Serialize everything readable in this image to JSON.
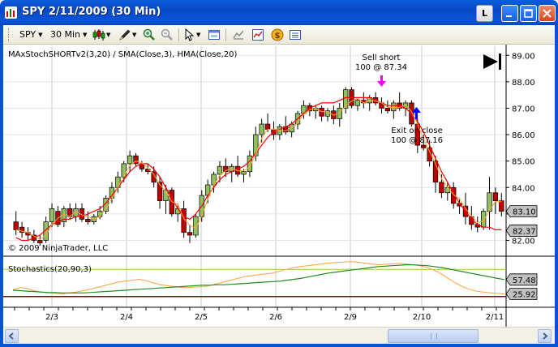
{
  "window": {
    "title": "SPY  2/11/2009 (30 Min)",
    "buttons": {
      "l_label": "L",
      "minimize": "–",
      "maximize": "□",
      "close": "✕"
    }
  },
  "toolbar": {
    "instrument": "SPY",
    "interval": "30 Min",
    "icons": [
      "candlestick-style-icon",
      "pencil-draw-icon",
      "zoom-in-icon",
      "zoom-out-icon",
      "cursor-icon",
      "properties-icon",
      "data-box-icon",
      "chart-trader-icon",
      "coin-icon",
      "list-icon"
    ]
  },
  "price_panel": {
    "label": "MAxStochSHORTv2(3,20) / SMA(Close,3), HMA(Close,20)",
    "copyright": "© 2009 NinjaTrader, LLC",
    "axis_ticks": [
      "89.00",
      "88.00",
      "87.00",
      "86.00",
      "85.00",
      "84.00",
      "83.00",
      "82.00"
    ],
    "price_markers": [
      {
        "label": "83.10",
        "color": "#c0c0c0"
      },
      {
        "label": "82.37",
        "color": "#c0c0c0"
      }
    ],
    "annotations": {
      "sell_short": [
        "Sell short",
        "100 @ 87.34"
      ],
      "exit_on_close": [
        "Exit on close",
        "100 @ 87.16"
      ]
    },
    "colors": {
      "up": "#90c060",
      "down": "#c00000",
      "hma": "#ff0000",
      "sma": "#ffaa30",
      "sell_arrow": "#ff00ff",
      "buy_arrow": "#0000ff"
    }
  },
  "stoch_panel": {
    "label": "Stochastics(20,90,3)",
    "markers": [
      {
        "label": "57.48",
        "color": "#c0c0c0"
      },
      {
        "label": "25.92",
        "color": "#c0c0c0"
      }
    ],
    "colors": {
      "d": "#228b22",
      "k": "#ffa040",
      "upper": "#9acd32",
      "lower": "#8b0000"
    }
  },
  "x_axis": {
    "labels": [
      "2/3",
      "2/4",
      "2/5",
      "2/6",
      "2/9",
      "2/10",
      "2/11"
    ]
  },
  "chart_data": {
    "type": "candlestick",
    "title": "SPY  2/11/2009 (30 Min)",
    "ylim": [
      81.8,
      89.1
    ],
    "series": [
      {
        "name": "SPY",
        "ohlc": [
          [
            82.7,
            83.1,
            82.2,
            82.4
          ],
          [
            82.5,
            82.7,
            82.1,
            82.3
          ],
          [
            82.3,
            82.5,
            82.0,
            82.2
          ],
          [
            82.2,
            82.4,
            81.9,
            82.0
          ],
          [
            82.0,
            82.2,
            81.8,
            81.9
          ],
          [
            82.0,
            82.9,
            81.9,
            82.7
          ],
          [
            82.7,
            83.4,
            82.5,
            83.2
          ],
          [
            83.1,
            83.3,
            82.5,
            82.6
          ],
          [
            82.7,
            83.3,
            82.5,
            83.2
          ],
          [
            83.2,
            83.4,
            82.8,
            82.9
          ],
          [
            82.9,
            83.4,
            82.7,
            83.2
          ],
          [
            83.2,
            83.4,
            82.7,
            82.8
          ],
          [
            82.8,
            83.1,
            82.6,
            82.7
          ],
          [
            82.7,
            83.0,
            82.6,
            82.9
          ],
          [
            82.9,
            83.3,
            82.8,
            83.1
          ],
          [
            83.1,
            83.7,
            83.0,
            83.6
          ],
          [
            83.6,
            84.2,
            83.4,
            84.0
          ],
          [
            84.0,
            84.6,
            83.8,
            84.4
          ],
          [
            84.4,
            85.0,
            84.2,
            84.9
          ],
          [
            84.9,
            85.4,
            84.6,
            85.2
          ],
          [
            85.2,
            85.3,
            84.8,
            84.9
          ],
          [
            84.9,
            85.0,
            84.6,
            84.7
          ],
          [
            84.7,
            84.9,
            84.5,
            84.6
          ],
          [
            84.6,
            84.8,
            84.0,
            84.2
          ],
          [
            84.2,
            84.4,
            83.2,
            83.5
          ],
          [
            83.5,
            84.1,
            83.0,
            83.9
          ],
          [
            83.9,
            84.0,
            82.9,
            83.0
          ],
          [
            83.0,
            83.4,
            82.7,
            83.2
          ],
          [
            83.2,
            83.5,
            82.1,
            82.3
          ],
          [
            82.3,
            82.6,
            81.9,
            82.2
          ],
          [
            82.2,
            83.0,
            82.1,
            82.9
          ],
          [
            82.9,
            83.9,
            82.7,
            83.7
          ],
          [
            83.7,
            84.3,
            83.4,
            84.1
          ],
          [
            84.1,
            84.6,
            83.8,
            84.5
          ],
          [
            84.5,
            85.0,
            84.2,
            84.8
          ],
          [
            84.8,
            85.1,
            84.4,
            84.6
          ],
          [
            84.6,
            84.9,
            84.2,
            84.8
          ],
          [
            84.8,
            85.2,
            84.4,
            84.5
          ],
          [
            84.5,
            84.7,
            84.2,
            84.6
          ],
          [
            84.6,
            85.4,
            84.4,
            85.2
          ],
          [
            85.2,
            86.3,
            85.0,
            86.0
          ],
          [
            86.0,
            86.6,
            85.7,
            86.4
          ],
          [
            86.4,
            86.8,
            86.1,
            86.2
          ],
          [
            86.2,
            86.5,
            85.8,
            86.0
          ],
          [
            86.0,
            86.4,
            85.8,
            86.3
          ],
          [
            86.3,
            86.7,
            86.0,
            86.1
          ],
          [
            86.1,
            86.5,
            85.9,
            86.4
          ],
          [
            86.4,
            86.9,
            86.2,
            86.8
          ],
          [
            86.8,
            87.3,
            86.6,
            87.1
          ],
          [
            87.1,
            87.2,
            86.7,
            86.9
          ],
          [
            86.9,
            87.1,
            86.6,
            87.0
          ],
          [
            87.0,
            87.1,
            86.5,
            86.7
          ],
          [
            86.7,
            87.0,
            86.5,
            86.9
          ],
          [
            86.9,
            87.1,
            86.4,
            86.6
          ],
          [
            86.6,
            87.2,
            86.3,
            87.0
          ],
          [
            87.0,
            87.8,
            86.8,
            87.7
          ],
          [
            87.7,
            87.8,
            87.0,
            87.1
          ],
          [
            87.1,
            87.4,
            86.9,
            87.3
          ],
          [
            87.3,
            87.6,
            87.0,
            87.2
          ],
          [
            87.2,
            87.5,
            86.9,
            87.4
          ],
          [
            87.4,
            87.6,
            87.1,
            87.2
          ],
          [
            87.2,
            87.4,
            86.8,
            87.0
          ],
          [
            87.0,
            87.3,
            86.8,
            86.9
          ],
          [
            86.9,
            87.3,
            86.6,
            87.2
          ],
          [
            87.2,
            87.6,
            86.9,
            87.0
          ],
          [
            87.0,
            87.3,
            86.7,
            87.2
          ],
          [
            87.2,
            87.3,
            86.3,
            86.4
          ],
          [
            86.4,
            86.6,
            85.3,
            85.6
          ],
          [
            85.6,
            86.0,
            85.4,
            85.5
          ],
          [
            85.5,
            85.8,
            84.8,
            85.0
          ],
          [
            85.0,
            85.2,
            83.8,
            84.2
          ],
          [
            84.2,
            84.5,
            83.6,
            83.8
          ],
          [
            83.8,
            84.2,
            83.5,
            84.0
          ],
          [
            84.0,
            84.2,
            83.2,
            83.4
          ],
          [
            83.4,
            83.6,
            83.0,
            83.3
          ],
          [
            83.3,
            83.8,
            82.6,
            82.9
          ],
          [
            82.9,
            83.3,
            82.4,
            82.6
          ],
          [
            82.6,
            82.9,
            82.3,
            82.5
          ],
          [
            82.5,
            83.2,
            82.4,
            83.1
          ],
          [
            83.1,
            84.4,
            82.4,
            83.8
          ],
          [
            83.8,
            84.0,
            83.0,
            83.5
          ],
          [
            83.5,
            83.8,
            82.9,
            83.1
          ]
        ]
      }
    ],
    "hma_series": [
      82.1,
      82.0,
      82.0,
      82.1,
      82.2,
      82.4,
      82.6,
      82.7,
      82.8,
      82.8,
      82.9,
      82.9,
      83.0,
      83.1,
      83.2,
      83.4,
      83.7,
      84.0,
      84.3,
      84.6,
      84.8,
      84.9,
      84.9,
      84.7,
      84.4,
      84.0,
      83.6,
      83.2,
      82.9,
      82.8,
      83.0,
      83.3,
      83.7,
      84.0,
      84.3,
      84.5,
      84.6,
      84.7,
      84.8,
      85.0,
      85.3,
      85.6,
      85.9,
      86.1,
      86.2,
      86.3,
      86.4,
      86.6,
      86.8,
      87.0,
      87.1,
      87.2,
      87.2,
      87.2,
      87.3,
      87.4,
      87.4,
      87.4,
      87.4,
      87.4,
      87.3,
      87.2,
      87.1,
      87.1,
      87.1,
      87.0,
      86.8,
      86.5,
      86.1,
      85.6,
      85.1,
      84.6,
      84.2,
      83.8,
      83.4,
      83.1,
      82.8,
      82.6,
      82.5,
      82.5,
      82.4,
      82.4
    ],
    "stochastics": {
      "upper_level": 80,
      "lower_level": 20,
      "d": [
        34,
        33,
        32,
        31,
        30,
        29,
        29,
        28,
        28,
        28,
        28,
        29,
        30,
        31,
        32,
        33,
        34,
        35,
        36,
        37,
        38,
        39,
        40,
        41,
        42,
        43,
        44,
        45,
        45,
        46,
        46,
        47,
        48,
        49,
        50,
        51,
        52,
        53,
        54,
        56,
        58,
        60,
        63,
        66,
        69,
        72,
        74,
        76,
        78,
        80,
        82,
        84,
        86,
        87,
        88,
        89,
        90,
        90,
        89,
        88,
        86,
        84,
        81,
        78,
        75,
        72,
        69,
        66,
        63,
        60,
        57.48
      ],
      "k": [
        35,
        40,
        38,
        33,
        30,
        28,
        27,
        26,
        28,
        30,
        33,
        36,
        40,
        44,
        48,
        52,
        54,
        56,
        58,
        55,
        50,
        46,
        44,
        42,
        40,
        40,
        41,
        42,
        44,
        48,
        52,
        56,
        60,
        64,
        66,
        68,
        70,
        72,
        76,
        80,
        84,
        86,
        88,
        90,
        92,
        94,
        95,
        96,
        97,
        96,
        94,
        92,
        90,
        91,
        92,
        93,
        92,
        90,
        88,
        84,
        78,
        70,
        60,
        50,
        42,
        36,
        32,
        30,
        28,
        27,
        25.92
      ]
    }
  }
}
